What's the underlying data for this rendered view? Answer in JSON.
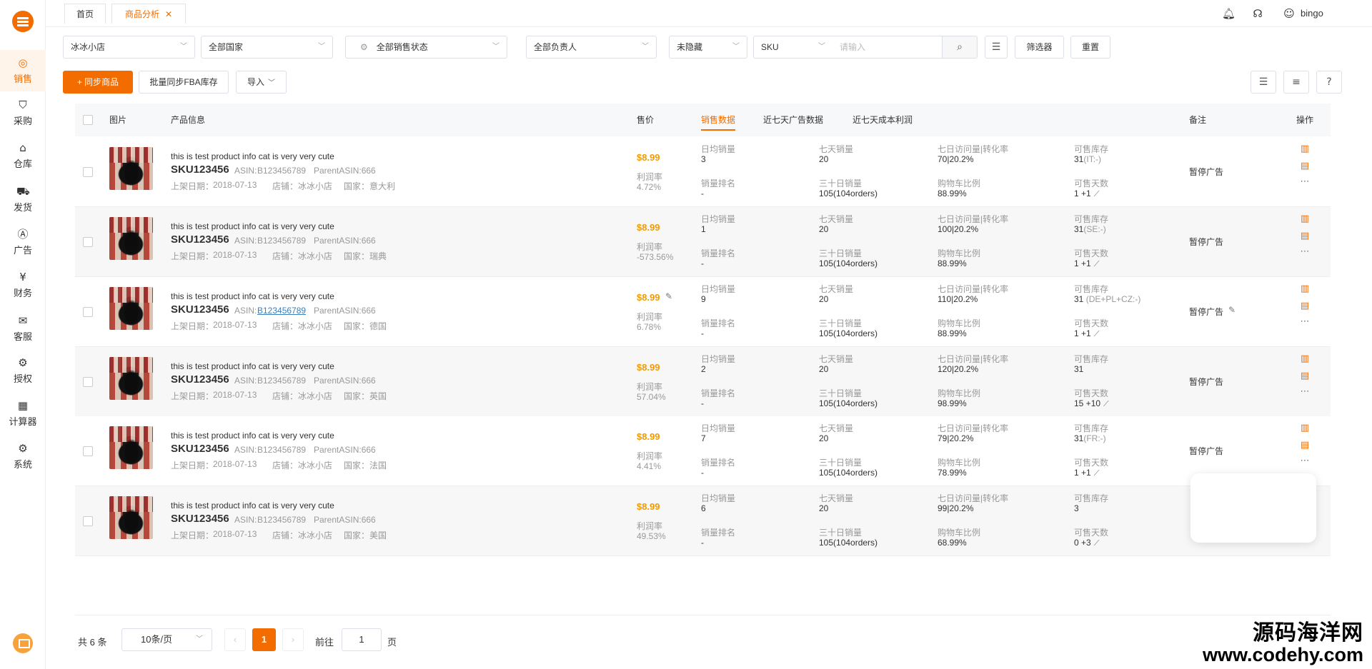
{
  "sidebar": {
    "items": [
      {
        "label": "销售",
        "icon": "sales-icon",
        "active": true
      },
      {
        "label": "采购",
        "icon": "basket-icon"
      },
      {
        "label": "仓库",
        "icon": "warehouse-icon"
      },
      {
        "label": "发货",
        "icon": "shipping-icon"
      },
      {
        "label": "广告",
        "icon": "ad-icon"
      },
      {
        "label": "财务",
        "icon": "yen-icon"
      },
      {
        "label": "客服",
        "icon": "mail-icon"
      },
      {
        "label": "授权",
        "icon": "gear-icon"
      },
      {
        "label": "计算器",
        "icon": "calculator-icon"
      },
      {
        "label": "系统",
        "icon": "settings-icon"
      }
    ]
  },
  "tabs": [
    {
      "label": "首页"
    },
    {
      "label": "商品分析",
      "closable": true
    }
  ],
  "header": {
    "username": "bingo",
    "close_glyph": "✕"
  },
  "filters": {
    "shop": "冰冰小店",
    "country": "全部国家",
    "sale_status": "全部销售状态",
    "owner": "全部负责人",
    "hidden": "未隐藏",
    "search_type": "SKU",
    "search_placeholder": "请输入",
    "filter_btn": "筛选器",
    "reset_btn": "重置"
  },
  "toolbar": {
    "sync_btn": "同步商品",
    "fba_btn": "批量同步FBA库存",
    "import_btn": "导入"
  },
  "table": {
    "headers": {
      "image": "图片",
      "product_info": "产品信息",
      "price": "售价",
      "tab_sales": "销售数据",
      "tab_ads": "近七天广告数据",
      "tab_profit": "近七天成本利润",
      "remark": "备注",
      "ops": "操作"
    },
    "labels": {
      "daily_sales": "日均销量",
      "seven_day_sales": "七天销量",
      "visits_conv": "七日访问量|转化率",
      "stock": "可售库存",
      "rank": "销量排名",
      "thirty_day_sales": "三十日销量",
      "cart_ratio": "购物车比例",
      "sell_days": "可售天数",
      "profit_rate": "利润率",
      "listed_prefix": "上架日期：",
      "shop_prefix": "店铺：",
      "country_prefix": "国家："
    },
    "rows": [
      {
        "title": "this is test product info cat is very very cute",
        "sku": "SKU123456",
        "asin_prefix": "ASIN:",
        "asin": "B123456789",
        "parent": "ParentASIN:666",
        "date": "2018-07-13",
        "shop": "冰冰小店",
        "country": "意大利",
        "price": "$8.99",
        "profit": "4.72%",
        "daily": "3",
        "seven": "20",
        "visits": "70|20.2%",
        "stock": "31",
        "stock_sub": "(IT:-)",
        "rank": "-",
        "thirty": "105(104orders)",
        "cart": "88.99%",
        "days": "1 +1",
        "remark": "暂停广告"
      },
      {
        "title": "this is test product info cat is very very cute",
        "sku": "SKU123456",
        "asin_prefix": "ASIN:",
        "asin": "B123456789",
        "parent": "ParentASIN:666",
        "date": "2018-07-13",
        "shop": "冰冰小店",
        "country": "瑞典",
        "price": "$8.99",
        "profit": "-573.56%",
        "daily": "1",
        "seven": "20",
        "visits": "100|20.2%",
        "stock": "31",
        "stock_sub": "(SE:-)",
        "rank": "-",
        "thirty": "105(104orders)",
        "cart": "88.99%",
        "days": "1 +1",
        "remark": "暂停广告"
      },
      {
        "title": "this is test product info cat is very very cute",
        "sku": "SKU123456",
        "asin_prefix": "ASIN:",
        "asin": "B123456789",
        "parent": "ParentASIN:666",
        "date": "2018-07-13",
        "shop": "冰冰小店",
        "country": "德国",
        "price": "$8.99",
        "profit": "6.78%",
        "daily": "9",
        "seven": "20",
        "visits": "110|20.2%",
        "stock": "31",
        "stock_sub": " (DE+PL+CZ:-)",
        "rank": "-",
        "thirty": "105(104orders)",
        "cart": "88.99%",
        "days": "1 +1",
        "remark": "暂停广告"
      },
      {
        "title": "this is test product info cat is very very cute",
        "sku": "SKU123456",
        "asin_prefix": "ASIN:",
        "asin": "B123456789",
        "parent": "ParentASIN:666",
        "date": "2018-07-13",
        "shop": "冰冰小店",
        "country": "英国",
        "price": "$8.99",
        "profit": "57.04%",
        "daily": "2",
        "seven": "20",
        "visits": "120|20.2%",
        "stock": "31",
        "stock_sub": "",
        "rank": "-",
        "thirty": "105(104orders)",
        "cart": "98.99%",
        "days": "15 +10",
        "remark": "暂停广告"
      },
      {
        "title": "this is test product info cat is very very cute",
        "sku": "SKU123456",
        "asin_prefix": "ASIN:",
        "asin": "B123456789",
        "parent": "ParentASIN:666",
        "date": "2018-07-13",
        "shop": "冰冰小店",
        "country": "法国",
        "price": "$8.99",
        "profit": "4.41%",
        "daily": "7",
        "seven": "20",
        "visits": "79|20.2%",
        "stock": "31",
        "stock_sub": "(FR:-)",
        "rank": "-",
        "thirty": "105(104orders)",
        "cart": "78.99%",
        "days": "1 +1",
        "remark": "暂停广告"
      },
      {
        "title": "this is test product info cat is very very cute",
        "sku": "SKU123456",
        "asin_prefix": "ASIN:",
        "asin": "B123456789",
        "parent": "ParentASIN:666",
        "date": "2018-07-13",
        "shop": "冰冰小店",
        "country": "美国",
        "price": "$8.99",
        "profit": "49.53%",
        "daily": "6",
        "seven": "20",
        "visits": "99|20.2%",
        "stock": "3",
        "stock_sub": "",
        "rank": "-",
        "thirty": "105(104orders)",
        "cart": "68.99%",
        "days": "0 +3",
        "remark": ""
      }
    ]
  },
  "pagination": {
    "total": "共 6 条",
    "page_size": "10条/页",
    "prev": "‹",
    "current": "1",
    "next": "›",
    "goto_label": "前往",
    "goto_value": "1",
    "page_suffix": "页"
  },
  "watermark": {
    "line1": "源码海洋网",
    "line2": "www.codehy.com"
  },
  "colors": {
    "accent": "#f26c00",
    "price": "#f29b00"
  }
}
